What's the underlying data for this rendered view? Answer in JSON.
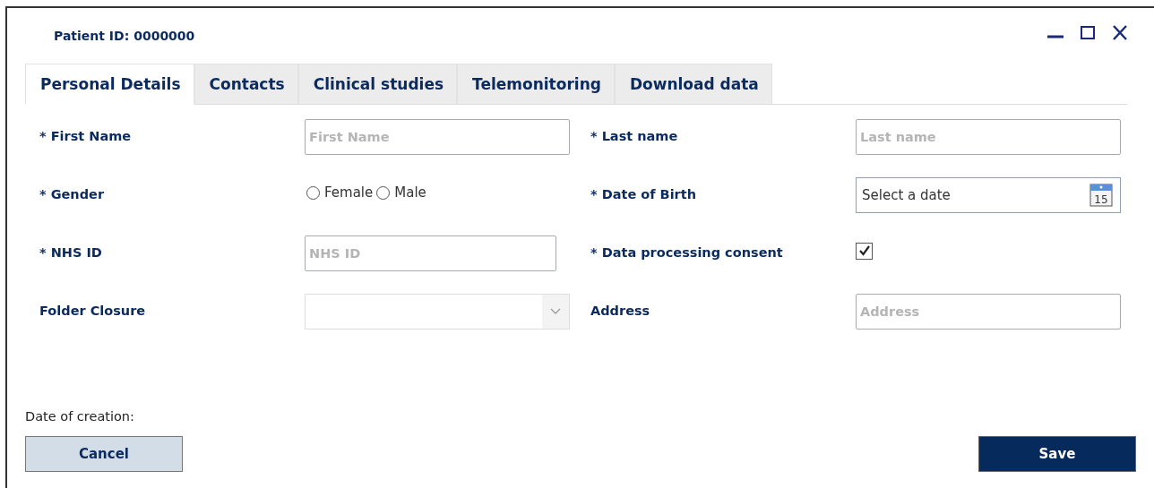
{
  "window": {
    "title": "Patient ID: 0000000",
    "controls": [
      {
        "kind": "minimize"
      },
      {
        "kind": "maximize"
      },
      {
        "kind": "close"
      }
    ]
  },
  "tabs": [
    {
      "label": "Personal Details",
      "selected": true
    },
    {
      "label": "Contacts",
      "selected": false
    },
    {
      "label": "Clinical studies",
      "selected": false
    },
    {
      "label": "Telemonitoring",
      "selected": false
    },
    {
      "label": "Download data",
      "selected": false
    }
  ],
  "fields": [
    {
      "label": "* First Name",
      "kind": "text",
      "placeholder": "First Name"
    },
    {
      "label": "* Last name",
      "kind": "text",
      "placeholder": "Last name"
    },
    {
      "label": "* Gender",
      "kind": "radio",
      "options": [
        {
          "label": "Female",
          "selected": false
        },
        {
          "label": "Male",
          "selected": false
        }
      ]
    },
    {
      "label": "* Date of Birth",
      "kind": "date",
      "value": "Select a date",
      "icon_text": "15"
    },
    {
      "label": "* NHS ID",
      "kind": "text",
      "placeholder": "NHS ID",
      "short": true
    },
    {
      "label": "* Data processing consent",
      "kind": "checkbox",
      "checked": true
    },
    {
      "label": "Folder Closure",
      "kind": "select",
      "disabled": true
    },
    {
      "label": "Address",
      "kind": "text",
      "placeholder": "Address"
    }
  ],
  "date_of_creation": "Date of creation:",
  "buttons": [
    {
      "label": "Cancel",
      "kind": "secondary"
    },
    {
      "label": "Save",
      "kind": "primary"
    }
  ]
}
